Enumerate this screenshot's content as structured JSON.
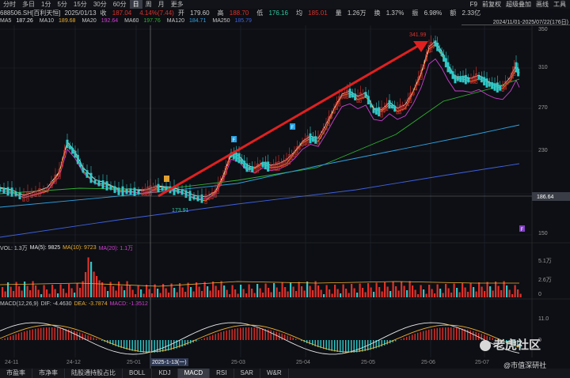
{
  "topbar": {
    "tabs": [
      {
        "label": "分时"
      },
      {
        "label": "多日"
      },
      {
        "label": "1分"
      },
      {
        "label": "5分"
      },
      {
        "label": "15分"
      },
      {
        "label": "30分"
      },
      {
        "label": "60分"
      },
      {
        "label": "日",
        "active": true
      },
      {
        "label": "周"
      },
      {
        "label": "月"
      },
      {
        "label": "更多"
      }
    ],
    "right": [
      "F9",
      "前复权",
      "超级叠加",
      "画线",
      "工具"
    ]
  },
  "quote": {
    "code": "688506.SH[百利天恒]",
    "date": "2025/01/13",
    "close_label": "收",
    "close": "187.04",
    "change": "4.14%(7.44)",
    "open_label": "开",
    "open": "179.60",
    "high_label": "高",
    "high": "188.70",
    "low_label": "低",
    "low": "176.16",
    "avg_label": "均",
    "avg": "185.01",
    "vol_label": "量",
    "vol": "1.26万",
    "turnover_label": "换",
    "turnover": "1.37%",
    "amp_label": "振",
    "amp": "6.98%",
    "amt_label": "额",
    "amt": "2.33亿"
  },
  "ma": {
    "ma5": "MA5",
    "ma5_v": "187.26",
    "ma10": "MA10",
    "ma10_v": "189.68",
    "ma20": "MA20",
    "ma20_v": "192.64",
    "ma60": "MA60",
    "ma60_v": "197.76",
    "ma120": "MA120",
    "ma120_v": "184.71",
    "ma250": "MA250",
    "ma250_v": "185.79",
    "range": "2024/11/01-2025/07/22(176日)"
  },
  "price_axis": [
    "350",
    "310",
    "270",
    "230",
    "190",
    "150"
  ],
  "price_current": "186.64",
  "annotations": {
    "high": "341.99",
    "low": "173.91",
    "f_marker": "F",
    "f_marker2": "F"
  },
  "volume": {
    "hdr_name": "VOL: 1.3万",
    "ma5": "MA(5): 9825",
    "ma10": "MA(10): 9723",
    "ma20": "MA(20): 1.1万",
    "axis": [
      "5.1万",
      "2.6万",
      "0"
    ]
  },
  "macd": {
    "hdr_name": "MACD(12,26,9)",
    "dif": "DIF: -4.4630",
    "dea": "DEA: -3.7874",
    "macd": "MACD: -1.3512",
    "axis": [
      "11.0",
      "0"
    ]
  },
  "dates": [
    "24-11",
    "24-12",
    "25-01",
    "25-03",
    "25-04",
    "25-05",
    "25-06",
    "25-07"
  ],
  "date_selected": "2025-1-13(一)",
  "bottom_tabs": [
    {
      "label": "市盈率"
    },
    {
      "label": "市净率"
    },
    {
      "label": "陆股通持股占比"
    },
    {
      "label": "BOLL"
    },
    {
      "label": "KDJ"
    },
    {
      "label": "MACD",
      "active": true
    },
    {
      "label": "RSI"
    },
    {
      "label": "SAR"
    },
    {
      "label": "W&R"
    }
  ],
  "watermark": {
    "line1": "老虎社区",
    "line2": "@市值深研社"
  },
  "colors": {
    "up": "#e0302a",
    "down": "#30c8c8",
    "ma5": "#e8e8e8",
    "ma10": "#f0b030",
    "ma20": "#d040d0",
    "ma60": "#30b030",
    "ma120": "#30a0e0",
    "ma250": "#4060e0",
    "arrow": "#e02020"
  }
}
